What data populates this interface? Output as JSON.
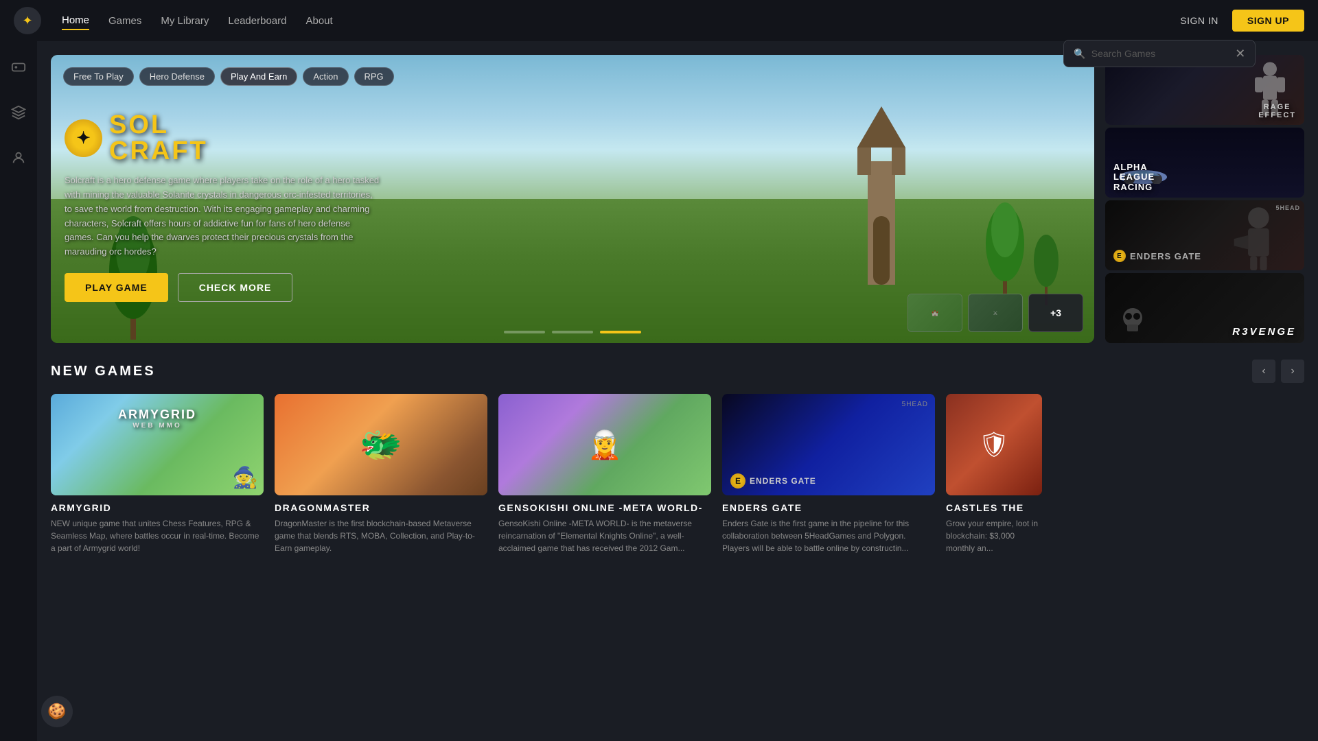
{
  "nav": {
    "logo": "⚡",
    "links": [
      {
        "label": "Home",
        "active": true
      },
      {
        "label": "Games",
        "active": false
      },
      {
        "label": "My Library",
        "active": false
      },
      {
        "label": "Leaderboard",
        "active": false
      },
      {
        "label": "About",
        "active": false
      }
    ],
    "search_placeholder": "Search Games",
    "signin_label": "SIGN IN",
    "signup_label": "SIGN UP"
  },
  "hero": {
    "tags": [
      {
        "label": "Free To Play",
        "active": false
      },
      {
        "label": "Hero Defense",
        "active": false
      },
      {
        "label": "Play And Earn",
        "active": true
      },
      {
        "label": "Action",
        "active": false
      },
      {
        "label": "RPG",
        "active": false
      }
    ],
    "game_logo": "SOL CRAFT",
    "game_logo_sub": "★",
    "description": "Solcraft is a hero defense game where players take on the role of a hero tasked with mining the valuable Solanite crystals in dangerous orc-infested territories, to save the world from destruction. With its engaging gameplay and charming characters, Solcraft offers hours of addictive fun for fans of hero defense games. Can you help the dwarves protect their precious crystals from the marauding orc hordes?",
    "btn_play": "PLAY GAME",
    "btn_check": "CHECK MORE",
    "thumb_plus": "+3",
    "dots": 3
  },
  "sidebar_games": [
    {
      "title": "RAGE EFFECT",
      "bg": "rage"
    },
    {
      "title": "ALPHA LEAGUE RACING",
      "bg": "alpha"
    },
    {
      "title": "ENDERS GATE",
      "bg": "enders"
    },
    {
      "title": "REVENGE",
      "bg": "revenge"
    }
  ],
  "new_games": {
    "section_title": "NEW GAMES",
    "nav_prev": "‹",
    "nav_next": "›",
    "games": [
      {
        "name": "ARMYGRID",
        "bg": "armygrid",
        "desc": "NEW unique game that unites Chess Features, RPG & Seamless Map, where battles occur in real-time. Become a part of Armygrid world!",
        "logo": "ARMYGRID",
        "logo_sub": "WEB MMO"
      },
      {
        "name": "DRAGONMASTER",
        "bg": "dragonmaster",
        "desc": "DragonMaster is the first blockchain-based Metaverse game that blends RTS, MOBA, Collection, and Play-to-Earn gameplay."
      },
      {
        "name": "GENSOKISHI ONLINE -META WORLD-",
        "bg": "gensokishi",
        "desc": "GensoKishi Online -META WORLD- is the metaverse reincarnation of \"Elemental Knights Online\", a well-acclaimed game that has received the 2012 Gam..."
      },
      {
        "name": "ENDERS GATE",
        "bg": "endersgate",
        "desc": "Enders Gate is the first game in the pipeline for this collaboration between 5HeadGames and Polygon. Players will be able to battle online by constructin..."
      },
      {
        "name": "CASTLES THE",
        "bg": "castles",
        "desc": "Grow your empire, loot in blockchain: $3,000 monthly an..."
      }
    ]
  },
  "cookie_icon": "🍪"
}
